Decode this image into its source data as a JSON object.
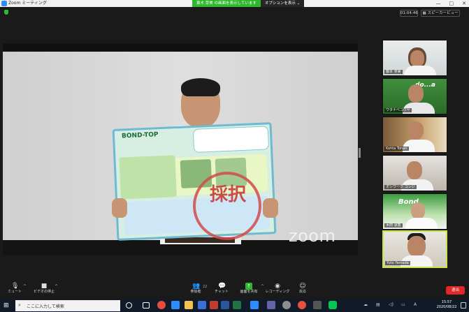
{
  "window": {
    "title": "Zoom ミーティング",
    "minimize": "—",
    "maximize": "□",
    "close": "✕"
  },
  "share_banner": {
    "status": "東木 芽美 の画面を表示しています",
    "options": "オプションを表示 ⌄"
  },
  "topbar": {
    "timer": "01:04:46",
    "view": "▦ スピーカービュー",
    "fullscreen": "⤢"
  },
  "main_video": {
    "poster_title": "BOND-TOP",
    "stamp": "採択",
    "watermark": "zoom"
  },
  "participants": [
    {
      "name": "藤本 芽実"
    },
    {
      "name": "ワタナベコウヤ",
      "logo": "do...a"
    },
    {
      "name": "Kohta Tohan"
    },
    {
      "name": "オシワーク コンジ"
    },
    {
      "name": "木田 涼香",
      "logo": "Bond"
    },
    {
      "name": "Yuto Yamada"
    }
  ],
  "toolbar": {
    "mute": "ミュート",
    "video": "ビデオの停止",
    "participants": "参加者",
    "participants_count": "22",
    "chat": "チャット",
    "share": "画面を共有",
    "record": "レコーディング",
    "reactions": "反応",
    "end": "退出"
  },
  "taskbar": {
    "search_placeholder": "ここに入力して検索",
    "time": "15:57",
    "date": "2020/08/22",
    "ime": "A"
  }
}
